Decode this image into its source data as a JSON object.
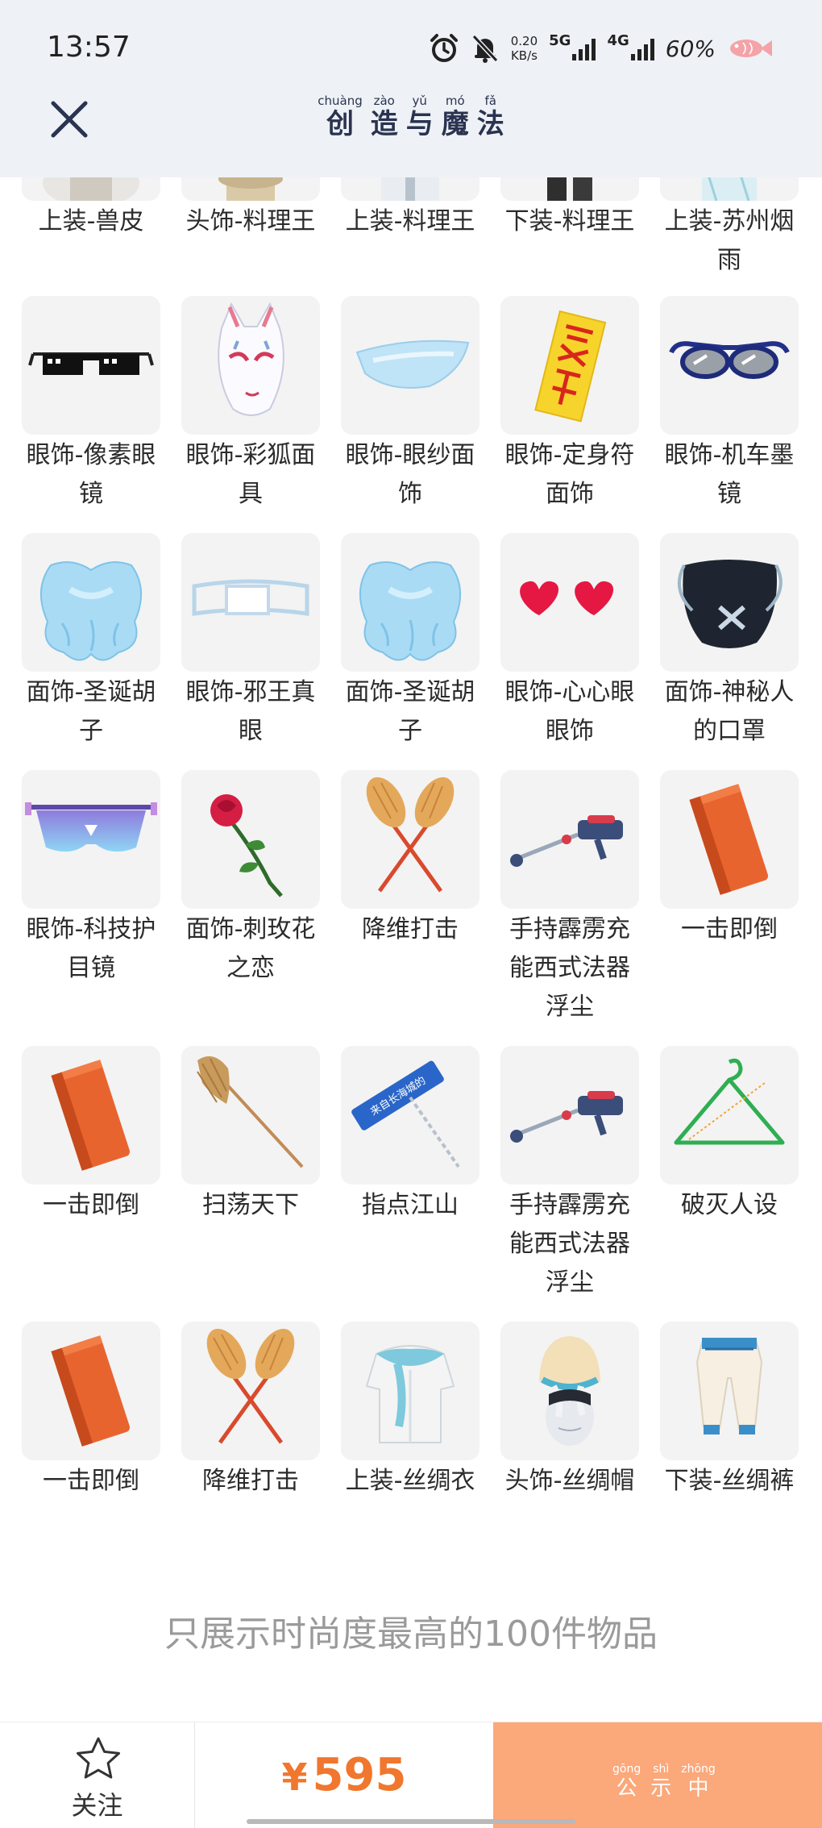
{
  "status_bar": {
    "time": "13:57",
    "net_speed_value": "0.20",
    "net_speed_unit": "KB/s",
    "signal_5g": "5G",
    "signal_4g": "4G",
    "battery": "60%",
    "icons": [
      "alarm-icon",
      "mute-bell-icon",
      "signal-5g-icon",
      "signal-4g-icon",
      "fish-battery-icon"
    ]
  },
  "nav": {
    "close_icon": "close-icon",
    "title_chars": [
      {
        "pinyin": "chuàng",
        "hanzi": "创"
      },
      {
        "pinyin": "zào",
        "hanzi": "造"
      },
      {
        "pinyin": "yǔ",
        "hanzi": "与"
      },
      {
        "pinyin": "mó",
        "hanzi": "魔"
      },
      {
        "pinyin": "fǎ",
        "hanzi": "法"
      }
    ]
  },
  "items": [
    {
      "label": "上装-兽皮",
      "icon": "fur-top-icon"
    },
    {
      "label": "头饰-料理王",
      "icon": "chef-hat-icon"
    },
    {
      "label": "上装-料理王",
      "icon": "chef-top-icon"
    },
    {
      "label": "下装-料理王",
      "icon": "chef-pants-icon"
    },
    {
      "label": "上装-苏州烟雨",
      "icon": "suzhou-top-icon"
    },
    {
      "label": "眼饰-像素眼镜",
      "icon": "pixel-glasses-icon"
    },
    {
      "label": "眼饰-彩狐面具",
      "icon": "fox-mask-icon"
    },
    {
      "label": "眼饰-眼纱面饰",
      "icon": "eye-veil-icon"
    },
    {
      "label": "眼饰-定身符面饰",
      "icon": "talisman-icon"
    },
    {
      "label": "眼饰-机车墨镜",
      "icon": "moto-sunglasses-icon"
    },
    {
      "label": "面饰-圣诞胡子",
      "icon": "santa-beard-icon"
    },
    {
      "label": "眼饰-邪王真眼",
      "icon": "eye-patch-icon"
    },
    {
      "label": "面饰-圣诞胡子",
      "icon": "santa-beard-icon"
    },
    {
      "label": "眼饰-心心眼眼饰",
      "icon": "heart-eyes-icon"
    },
    {
      "label": "面饰-神秘人的口罩",
      "icon": "mask-icon"
    },
    {
      "label": "眼饰-科技护目镜",
      "icon": "tech-goggles-icon"
    },
    {
      "label": "面饰-刺玫花之恋",
      "icon": "rose-icon"
    },
    {
      "label": "降维打击",
      "icon": "crossed-dusters-icon"
    },
    {
      "label": "手持霹雳充能西式法器浮尘",
      "icon": "vacuum-icon"
    },
    {
      "label": "一击即倒",
      "icon": "brick-icon"
    },
    {
      "label": "一击即倒",
      "icon": "brick-icon"
    },
    {
      "label": "扫荡天下",
      "icon": "broom-icon"
    },
    {
      "label": "指点江山",
      "icon": "sign-pointer-icon"
    },
    {
      "label": "手持霹雳充能西式法器浮尘",
      "icon": "vacuum-icon"
    },
    {
      "label": "破灭人设",
      "icon": "hanger-icon"
    },
    {
      "label": "一击即倒",
      "icon": "brick-icon"
    },
    {
      "label": "降维打击",
      "icon": "crossed-dusters-icon"
    },
    {
      "label": "上装-丝绸衣",
      "icon": "silk-top-icon"
    },
    {
      "label": "头饰-丝绸帽",
      "icon": "turban-icon"
    },
    {
      "label": "下装-丝绸裤",
      "icon": "silk-pants-icon"
    }
  ],
  "sign_text": "来自长海城的",
  "footer_note": "只展示时尚度最高的100件物品",
  "bottom_bar": {
    "follow_label": "关注",
    "currency": "¥",
    "price": "595",
    "publicity_chars": [
      {
        "pinyin": "gōng",
        "hanzi": "公"
      },
      {
        "pinyin": "shì",
        "hanzi": "示"
      },
      {
        "pinyin": "zhōng",
        "hanzi": "中"
      }
    ]
  },
  "colors": {
    "accent_price": "#f0772d",
    "publicity_bg": "#fba87b",
    "header_bg": "#eef2f6",
    "title_color": "#2a3350"
  }
}
